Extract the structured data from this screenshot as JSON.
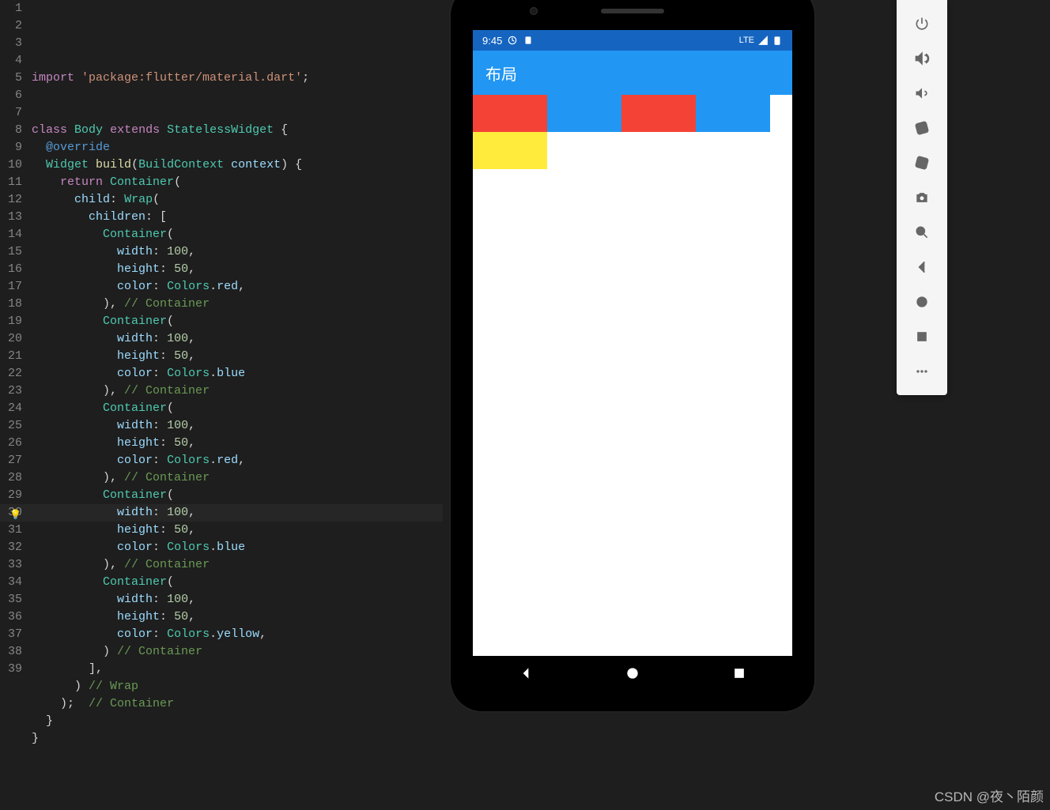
{
  "code": {
    "lines": [
      {
        "n": 1,
        "html": "<span class='kw'>import</span> <span class='str'>'package:flutter/material.dart'</span><span class='pun'>;</span>"
      },
      {
        "n": 2,
        "html": ""
      },
      {
        "n": 3,
        "html": ""
      },
      {
        "n": 4,
        "html": "<span class='kw'>class</span> <span class='type'>Body</span> <span class='kw'>extends</span> <span class='type'>StatelessWidget</span> <span class='pun'>{</span>"
      },
      {
        "n": 5,
        "html": "  <span class='kw2'>@override</span>"
      },
      {
        "n": 6,
        "html": "  <span class='type'>Widget</span> <span class='id'>build</span><span class='pun'>(</span><span class='type'>BuildContext</span> <span class='prop'>context</span><span class='pun'>) {</span>"
      },
      {
        "n": 7,
        "html": "    <span class='kw'>return</span> <span class='type'>Container</span><span class='pun'>(</span>"
      },
      {
        "n": 8,
        "html": "      <span class='prop'>child</span><span class='pun'>:</span> <span class='type'>Wrap</span><span class='pun'>(</span>"
      },
      {
        "n": 9,
        "html": "        <span class='prop'>children</span><span class='pun'>: [</span>"
      },
      {
        "n": 10,
        "html": "          <span class='type'>Container</span><span class='pun'>(</span>"
      },
      {
        "n": 11,
        "html": "            <span class='prop'>width</span><span class='pun'>:</span> <span class='num'>100</span><span class='pun'>,</span>"
      },
      {
        "n": 12,
        "html": "            <span class='prop'>height</span><span class='pun'>:</span> <span class='num'>50</span><span class='pun'>,</span>"
      },
      {
        "n": 13,
        "html": "            <span class='prop'>color</span><span class='pun'>:</span> <span class='type'>Colors</span><span class='pun'>.</span><span class='prop'>red</span><span class='pun'>,</span>"
      },
      {
        "n": 14,
        "html": "          <span class='pun'>),</span> <span class='com'>// Container</span>"
      },
      {
        "n": 15,
        "html": "          <span class='type'>Container</span><span class='pun'>(</span>"
      },
      {
        "n": 16,
        "html": "            <span class='prop'>width</span><span class='pun'>:</span> <span class='num'>100</span><span class='pun'>,</span>"
      },
      {
        "n": 17,
        "html": "            <span class='prop'>height</span><span class='pun'>:</span> <span class='num'>50</span><span class='pun'>,</span>"
      },
      {
        "n": 18,
        "html": "            <span class='prop'>color</span><span class='pun'>:</span> <span class='type'>Colors</span><span class='pun'>.</span><span class='prop'>blue</span>"
      },
      {
        "n": 19,
        "html": "          <span class='pun'>),</span> <span class='com'>// Container</span>"
      },
      {
        "n": 20,
        "html": "          <span class='type'>Container</span><span class='pun'>(</span>"
      },
      {
        "n": 21,
        "html": "            <span class='prop'>width</span><span class='pun'>:</span> <span class='num'>100</span><span class='pun'>,</span>"
      },
      {
        "n": 22,
        "html": "            <span class='prop'>height</span><span class='pun'>:</span> <span class='num'>50</span><span class='pun'>,</span>"
      },
      {
        "n": 23,
        "html": "            <span class='prop'>color</span><span class='pun'>:</span> <span class='type'>Colors</span><span class='pun'>.</span><span class='prop'>red</span><span class='pun'>,</span>"
      },
      {
        "n": 24,
        "html": "          <span class='pun'>),</span> <span class='com'>// Container</span>"
      },
      {
        "n": 25,
        "html": "          <span class='type'>Container</span><span class='pun'>(</span>"
      },
      {
        "n": 26,
        "html": "            <span class='prop'>width</span><span class='pun'>:</span> <span class='num'>100</span><span class='pun'>,</span>"
      },
      {
        "n": 27,
        "html": "            <span class='prop'>height</span><span class='pun'>:</span> <span class='num'>50</span><span class='pun'>,</span>"
      },
      {
        "n": 28,
        "html": "            <span class='prop'>color</span><span class='pun'>:</span> <span class='type'>Colors</span><span class='pun'>.</span><span class='prop'>blue</span>"
      },
      {
        "n": 29,
        "html": "          <span class='pun'>),</span> <span class='com'>// Container</span>"
      },
      {
        "n": 30,
        "html": "          <span class='type'>Container</span><span class='pun'>(</span>"
      },
      {
        "n": 31,
        "html": "            <span class='prop'>width</span><span class='pun'>:</span> <span class='num'>100</span><span class='pun'>,</span>"
      },
      {
        "n": 32,
        "html": "            <span class='prop'>height</span><span class='pun'>:</span> <span class='num'>50</span><span class='pun'>,</span>"
      },
      {
        "n": 33,
        "html": "            <span class='prop'>color</span><span class='pun'>:</span> <span class='type'>Colors</span><span class='pun'>.</span><span class='prop'>yellow</span><span class='pun'>,</span>"
      },
      {
        "n": 34,
        "html": "          <span class='pun'>)</span> <span class='com'>// Container</span>"
      },
      {
        "n": 35,
        "html": "        <span class='pun'>],</span>"
      },
      {
        "n": 36,
        "html": "      <span class='pun'>)</span> <span class='com'>// Wrap</span>"
      },
      {
        "n": 37,
        "html": "    <span class='pun'>);</span>  <span class='com'>// Container</span>"
      },
      {
        "n": 38,
        "html": "  <span class='pun'>}</span>"
      },
      {
        "n": 39,
        "html": "<span class='pun'>}</span>"
      }
    ],
    "active_line": 30
  },
  "phone": {
    "status_time": "9:45",
    "status_network": "LTE",
    "app_title": "布局",
    "boxes": [
      {
        "color": "red"
      },
      {
        "color": "blue"
      },
      {
        "color": "red"
      },
      {
        "color": "blue"
      },
      {
        "color": "yellow"
      }
    ]
  },
  "emu_toolbar": [
    {
      "name": "power-icon"
    },
    {
      "name": "volume-up-icon"
    },
    {
      "name": "volume-down-icon"
    },
    {
      "name": "rotate-left-icon"
    },
    {
      "name": "rotate-right-icon"
    },
    {
      "name": "screenshot-icon"
    },
    {
      "name": "zoom-icon"
    },
    {
      "name": "back-icon"
    },
    {
      "name": "home-icon"
    },
    {
      "name": "overview-icon"
    },
    {
      "name": "more-icon"
    }
  ],
  "watermark": "CSDN @夜丶陌颜"
}
